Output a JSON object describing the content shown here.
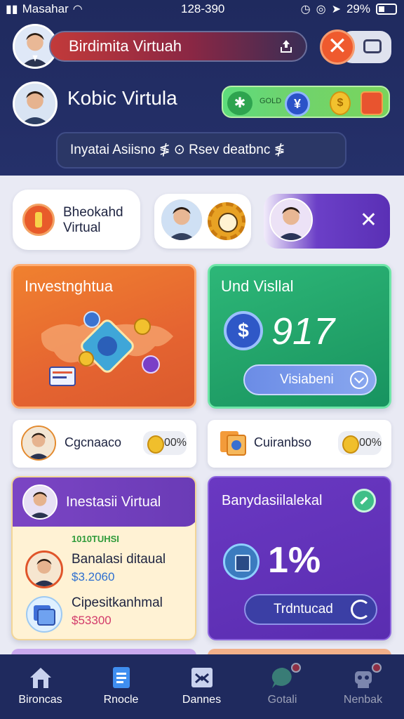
{
  "status_bar": {
    "carrier": "Masahar",
    "time": "128-390",
    "battery": "29%"
  },
  "header": {
    "name_bar": "Birdimita Virtuah",
    "profile_name": "Kobic Virtula",
    "reward_label": "GOLD",
    "reward_coin": "$",
    "search_text": "Inyatai Asiisno ≸ ⊙ Rsev deatbnc ≸"
  },
  "quick": {
    "item1_label_line1": "Bheokahd",
    "item1_label_line2": "Virtual",
    "close_glyph": "✕"
  },
  "cards": {
    "invest": {
      "title": "Investnghtua"
    },
    "green": {
      "title": "Und Visllal",
      "coin": "$",
      "value": "917",
      "button": "Visiabeni"
    }
  },
  "stats": [
    {
      "label": "Cgcnaaco",
      "pct": "00%"
    },
    {
      "label": "Cuiranbso",
      "pct": "00%"
    }
  ],
  "yellow_card": {
    "title": "Inestasii Virtual",
    "tag": "1010TUHSI",
    "rows": [
      {
        "label": "Banalasi ditaual",
        "value": "$3.2060"
      },
      {
        "label": "Cipesitkanhmal",
        "value": "$53300"
      }
    ]
  },
  "purple_card": {
    "title": "Banydasiilalekal",
    "value": "1%",
    "button": "Trdntucad"
  },
  "nav": [
    {
      "label": "Bironcas",
      "icon": "home-icon"
    },
    {
      "label": "Rnocle",
      "icon": "document-icon"
    },
    {
      "label": "Dannes",
      "icon": "mail-icon"
    },
    {
      "label": "Gotali",
      "icon": "chat-icon"
    },
    {
      "label": "Nenbak",
      "icon": "robot-icon"
    }
  ],
  "colors": {
    "header": "#1f2a5e",
    "orange": "#e56431",
    "green": "#21a168",
    "purple": "#5a2db0",
    "accent_red": "#ef5a2e"
  }
}
